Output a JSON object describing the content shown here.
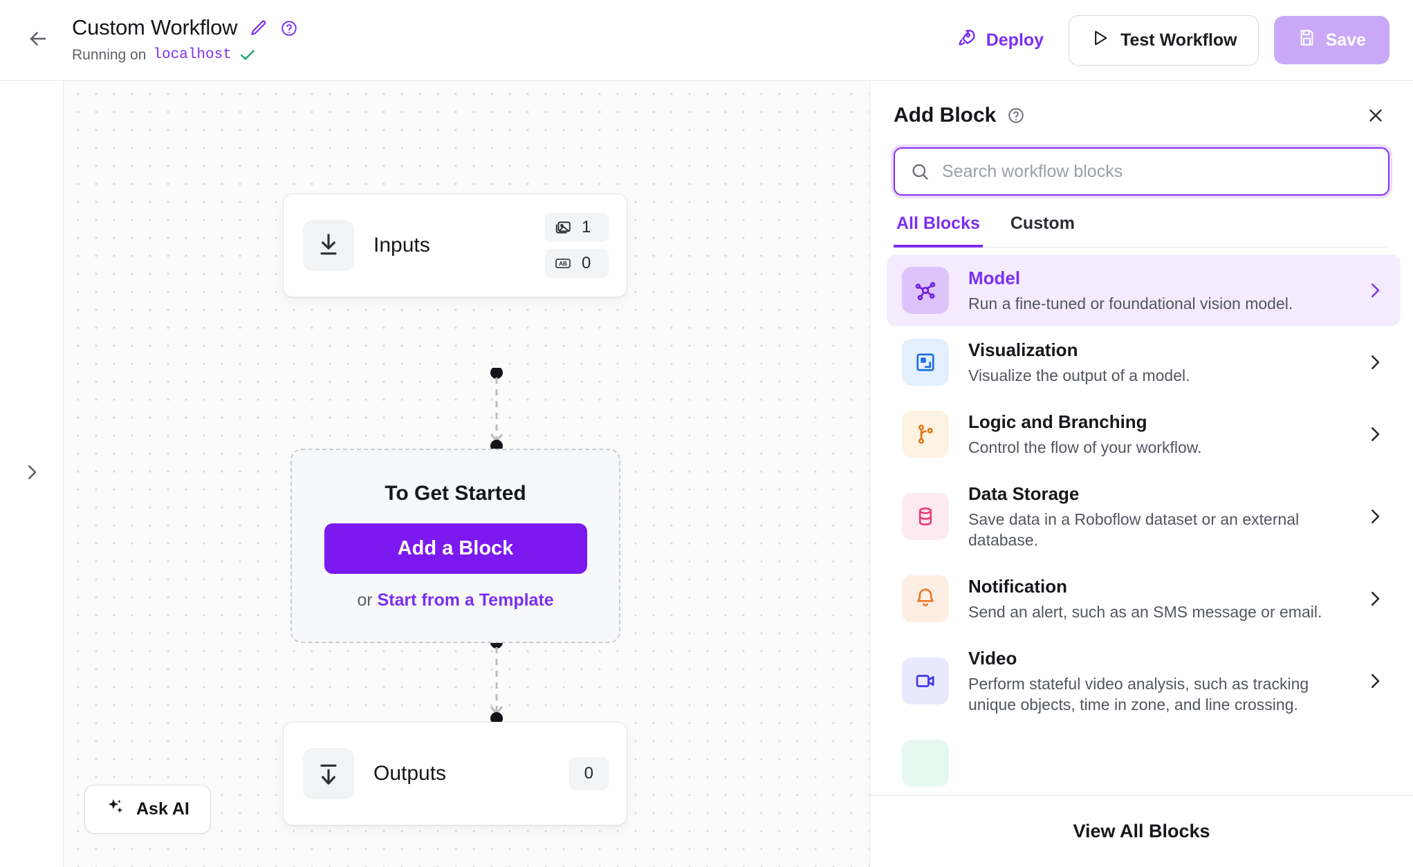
{
  "header": {
    "back_icon": "arrow-left-icon",
    "title": "Custom Workflow",
    "edit_icon": "pencil-icon",
    "help_icon": "question-circle-icon",
    "status_prefix": "Running on",
    "status_host": "localhost",
    "status_check_icon": "check-icon",
    "deploy_label": "Deploy",
    "deploy_icon": "rocket-icon",
    "test_label": "Test Workflow",
    "test_icon": "play-icon",
    "save_label": "Save",
    "save_icon": "floppy-disk-icon",
    "accent_color": "#7b2ff2",
    "save_bg_color": "#c9a9f7"
  },
  "left_rail": {
    "expand_icon": "chevron-right-icon"
  },
  "canvas": {
    "inputs_node": {
      "label": "Inputs",
      "icon": "download-arrow-icon",
      "badges": [
        {
          "icon": "image-icon",
          "value": "1"
        },
        {
          "icon": "ab-text-icon",
          "value": "0"
        }
      ]
    },
    "start_card": {
      "title": "To Get Started",
      "primary_button": "Add a Block",
      "or_text": "or ",
      "link_text": "Start from a Template",
      "button_color": "#7c18f0"
    },
    "outputs_node": {
      "label": "Outputs",
      "icon": "upload-bar-arrow-icon",
      "count": "0"
    },
    "ask_ai": {
      "label": "Ask AI",
      "icon": "sparkles-icon"
    }
  },
  "panel": {
    "title": "Add Block",
    "help_icon": "question-circle-icon",
    "close_icon": "close-icon",
    "search": {
      "placeholder": "Search workflow blocks",
      "value": "",
      "icon": "search-icon"
    },
    "tabs": [
      {
        "label": "All Blocks",
        "active": true
      },
      {
        "label": "Custom",
        "active": false
      }
    ],
    "blocks": [
      {
        "name": "Model",
        "desc": "Run a fine-tuned or foundational vision model.",
        "icon": "model-graph-icon",
        "icon_color": "#6f1fe0",
        "icon_bg": "#dcc4fa",
        "active": true
      },
      {
        "name": "Visualization",
        "desc": "Visualize the output of a model.",
        "icon": "visualization-image-icon",
        "icon_color": "#1f6fe0",
        "icon_bg": "#e3effc",
        "active": false
      },
      {
        "name": "Logic and Branching",
        "desc": "Control the flow of your workflow.",
        "icon": "git-branch-icon",
        "icon_color": "#e07b18",
        "icon_bg": "#fdf3e3",
        "active": false
      },
      {
        "name": "Data Storage",
        "desc": "Save data in a Roboflow dataset or an external database.",
        "icon": "database-icon",
        "icon_color": "#ea3b7a",
        "icon_bg": "#fdeaf1",
        "active": false
      },
      {
        "name": "Notification",
        "desc": "Send an alert, such as an SMS message or email.",
        "icon": "bell-icon",
        "icon_color": "#f0752a",
        "icon_bg": "#fdeee3",
        "active": false
      },
      {
        "name": "Video",
        "desc": "Perform stateful video analysis, such as tracking unique objects, time in zone, and line crossing.",
        "icon": "video-camera-icon",
        "icon_color": "#4338e8",
        "icon_bg": "#e8e9fd",
        "active": false
      }
    ],
    "footer_label": "View All Blocks"
  }
}
